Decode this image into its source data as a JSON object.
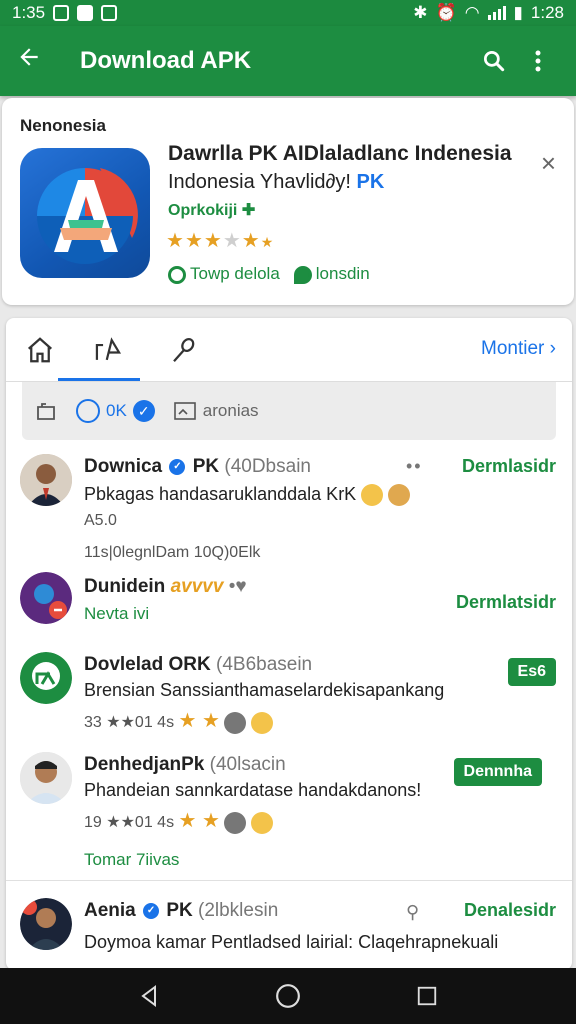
{
  "status": {
    "time_left": "1:35",
    "time_right": "1:28"
  },
  "appbar": {
    "title": "Download APK",
    "back_icon": "arrow-left-icon",
    "search_icon": "search-icon",
    "menu_icon": "more-vert-icon"
  },
  "featured": {
    "region": "Nenonesia",
    "title": "Dawrlla PK AIDlaladlanc Indenesia",
    "subtitle_prefix": "Indonesia Yhavlid∂y!",
    "subtitle_highlight": "PK",
    "developer": "Oprkokiji",
    "rating_stars": 3.5,
    "meta1": "Towp delola",
    "meta2": "lonsdin",
    "close": "×"
  },
  "tabs": {
    "items": [
      "home",
      "share",
      "search"
    ],
    "active_index": 1,
    "monitor_label": "Montier"
  },
  "filter": {
    "chip1": "0K",
    "chip2": "aronias"
  },
  "feed": [
    {
      "name": "Downica",
      "name_suffix": "PK",
      "meta": "(40Dbsain",
      "text": "Pbkagas handasaruklanddala KrK",
      "rating": "A5.0",
      "small": "11s|0legnlDam 10Q)0Elk",
      "action": "Dermlasidr"
    },
    {
      "name": "Dunidein",
      "name_suffix": "avvvv",
      "meta": "",
      "text": "Nevta ivi",
      "action": "Dermlatsidr"
    },
    {
      "name": "Dovlelad",
      "name_suffix": "ORK",
      "meta": "(4B6basein",
      "text": "Brensian Sanssianthamaselardekisapankang",
      "rating": "33 ★★01 4s",
      "action": "Es6"
    },
    {
      "name": "DenhedjanPk",
      "name_suffix": "",
      "meta": "(40lsacin",
      "text": "Phandeian sannkardatase handakdanons!",
      "rating": "19 ★★01 4s",
      "action": "Dennnha",
      "footer": "Tomar 7iivas"
    },
    {
      "name": "Aenia",
      "name_suffix": "PK",
      "meta": "(2lbklesin",
      "text": "Doymoa kamar Pentladsed lairial: Claqehrapnekuali",
      "action": "Denalesidr"
    }
  ],
  "colors": {
    "green": "#1d8d41",
    "blue": "#1a73e8",
    "star": "#e6a023"
  }
}
